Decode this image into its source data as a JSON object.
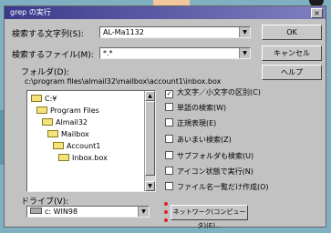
{
  "window": {
    "title": "grep の実行",
    "close_glyph": "×"
  },
  "search_text": {
    "label": "検索する文字列(S):",
    "value": "AL-Ma1132"
  },
  "search_file": {
    "label": "検索するファイル(M):",
    "value": "*.*"
  },
  "folder": {
    "label": "フォルダ(D):",
    "path": "c:\\program files\\almail32\\mailbox\\account1\\inbox.box"
  },
  "tree": [
    {
      "label": "C:¥",
      "icon": "folder-open-icon"
    },
    {
      "label": "Program Files",
      "icon": "folder-open-icon"
    },
    {
      "label": "Almail32",
      "icon": "folder-open-icon"
    },
    {
      "label": "Mailbox",
      "icon": "folder-open-icon"
    },
    {
      "label": "Account1",
      "icon": "folder-open-icon"
    },
    {
      "label": "Inbox.box",
      "icon": "folder-open-icon"
    }
  ],
  "options": [
    {
      "label": "大文字／小文字の区別(C)",
      "checked": true
    },
    {
      "label": "単語の検索(W)",
      "checked": false
    },
    {
      "label": "正規表現(E)",
      "checked": false
    },
    {
      "label": "あいまい検索(Z)",
      "checked": false
    },
    {
      "label": "サブフォルダも検索(U)",
      "checked": false
    },
    {
      "label": "アイコン状態で実行(N)",
      "checked": false
    },
    {
      "label": "ファイル名一覧だけ作成(O)",
      "checked": false
    }
  ],
  "drive": {
    "label": "ドライブ(V):",
    "value": "c: WIN98",
    "icon": "drive-icon"
  },
  "buttons": {
    "ok": "OK",
    "cancel": "キャンセル",
    "help": "ヘルプ",
    "network": "ネットワーク(コンピュータ)(E)..."
  },
  "colors": {
    "title_gradient_start": "#3a3a8c",
    "title_gradient_end": "#7f7fc0",
    "dialog_bg": "#c2c2c2",
    "highlight_dots": "#e0202a"
  }
}
